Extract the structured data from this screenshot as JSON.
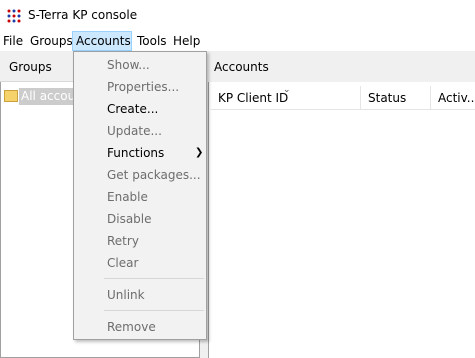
{
  "window": {
    "title": "S-Terra KP console"
  },
  "menubar": {
    "items": [
      "File",
      "Groups",
      "Accounts",
      "Tools",
      "Help"
    ]
  },
  "left_panel": {
    "header": "Groups",
    "tree_root": "All accounts"
  },
  "right_panel": {
    "header": "Accounts",
    "columns": [
      "KP Client ID",
      "Status",
      "Activ..."
    ]
  },
  "accounts_menu": {
    "items": [
      {
        "label": "Show...",
        "enabled": false
      },
      {
        "label": "Properties...",
        "enabled": false
      },
      {
        "label": "Create...",
        "enabled": true
      },
      {
        "label": "Update...",
        "enabled": false
      },
      {
        "label": "Functions",
        "enabled": true,
        "submenu": true
      },
      {
        "label": "Get packages...",
        "enabled": false
      },
      {
        "label": "Enable",
        "enabled": false
      },
      {
        "label": "Disable",
        "enabled": false
      },
      {
        "label": "Retry",
        "enabled": false
      },
      {
        "label": "Clear",
        "enabled": false
      },
      {
        "label": "Unlink",
        "enabled": false
      },
      {
        "label": "Remove",
        "enabled": false
      }
    ]
  },
  "colors": {
    "menu_highlight": "#cce8ff",
    "disabled_text": "#6d6d6d",
    "tree_selection": "#cccccc"
  }
}
